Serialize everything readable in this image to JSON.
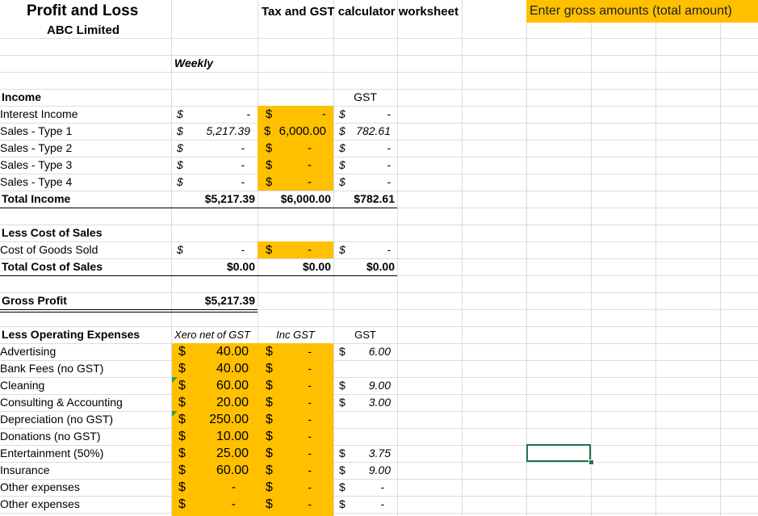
{
  "header": {
    "title": "Profit and Loss",
    "company": "ABC Limited",
    "worksheet_title": "Tax and GST calculator worksheet",
    "instruction": "Enter gross amounts (total amount)",
    "period": "Weekly"
  },
  "income": {
    "heading": "Income",
    "gst_header": "GST",
    "rows": [
      {
        "label": "Interest Income",
        "cur": "$",
        "net": "-",
        "inc_cur": "$",
        "inc": "-",
        "gst_cur": "$",
        "gst": "-"
      },
      {
        "label": "Sales - Type 1",
        "cur": "$",
        "net": "5,217.39",
        "inc_cur": "$",
        "inc": "6,000.00",
        "gst_cur": "$",
        "gst": "782.61"
      },
      {
        "label": "Sales - Type 2",
        "cur": "$",
        "net": "-",
        "inc_cur": "$",
        "inc": "-",
        "gst_cur": "$",
        "gst": "-"
      },
      {
        "label": "Sales - Type 3",
        "cur": "$",
        "net": "-",
        "inc_cur": "$",
        "inc": "-",
        "gst_cur": "$",
        "gst": "-"
      },
      {
        "label": "Sales - Type 4",
        "cur": "$",
        "net": "-",
        "inc_cur": "$",
        "inc": "-",
        "gst_cur": "$",
        "gst": "-"
      }
    ],
    "total_label": "Total Income",
    "total_net": "$5,217.39",
    "total_inc": "$6,000.00",
    "total_gst": "$782.61"
  },
  "cost_of_sales": {
    "heading": "Less Cost of Sales",
    "row": {
      "label": "Cost of Goods Sold",
      "cur": "$",
      "net": "-",
      "inc_cur": "$",
      "inc": "-",
      "gst_cur": "$",
      "gst": "-"
    },
    "total_label": "Total Cost of Sales",
    "total_net": "$0.00",
    "total_inc": "$0.00",
    "total_gst": "$0.00"
  },
  "gross_profit": {
    "label": "Gross Profit",
    "value": "$5,217.39"
  },
  "expenses": {
    "heading": "Less Operating Expenses",
    "col_net": "Xero net of GST",
    "col_inc": "Inc GST",
    "col_gst": "GST",
    "rows": [
      {
        "label": "Advertising",
        "cur": "$",
        "net": "40.00",
        "inc_cur": "$",
        "inc": "-",
        "gst_cur": "$",
        "gst": "6.00"
      },
      {
        "label": "Bank Fees (no GST)",
        "cur": "$",
        "net": "40.00",
        "inc_cur": "$",
        "inc": "-",
        "gst_cur": "",
        "gst": ""
      },
      {
        "label": "Cleaning",
        "cur": "$",
        "net": "60.00",
        "inc_cur": "$",
        "inc": "-",
        "gst_cur": "$",
        "gst": "9.00"
      },
      {
        "label": "Consulting & Accounting",
        "cur": "$",
        "net": "20.00",
        "inc_cur": "$",
        "inc": "-",
        "gst_cur": "$",
        "gst": "3.00"
      },
      {
        "label": "Depreciation (no GST)",
        "cur": "$",
        "net": "250.00",
        "inc_cur": "$",
        "inc": "-",
        "gst_cur": "",
        "gst": ""
      },
      {
        "label": "Donations (no GST)",
        "cur": "$",
        "net": "10.00",
        "inc_cur": "$",
        "inc": "-",
        "gst_cur": "",
        "gst": ""
      },
      {
        "label": "Entertainment (50%)",
        "cur": "$",
        "net": "25.00",
        "inc_cur": "$",
        "inc": "-",
        "gst_cur": "$",
        "gst": "3.75"
      },
      {
        "label": "Insurance",
        "cur": "$",
        "net": "60.00",
        "inc_cur": "$",
        "inc": "-",
        "gst_cur": "$",
        "gst": "9.00"
      },
      {
        "label": "Other expenses",
        "cur": "$",
        "net": "-",
        "inc_cur": "$",
        "inc": "-",
        "gst_cur": "$",
        "gst": "-"
      },
      {
        "label": "Other expenses",
        "cur": "$",
        "net": "-",
        "inc_cur": "$",
        "inc": "-",
        "gst_cur": "$",
        "gst": "-"
      }
    ]
  },
  "colors": {
    "input_fill": "#ffc000",
    "selection": "#217346",
    "gridline": "#dcdcdc"
  }
}
